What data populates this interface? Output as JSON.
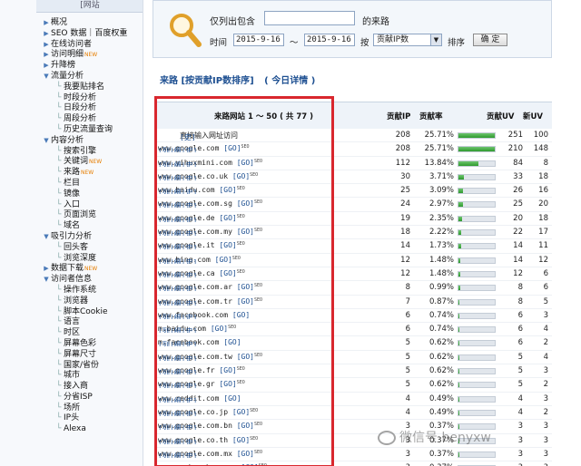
{
  "sidebar": {
    "site_name": "[网站",
    "items": [
      {
        "label": "概况",
        "level": 0
      },
      {
        "label": "SEO 数据｜百度权重",
        "level": 0
      },
      {
        "label": "在线访问者",
        "level": 0
      },
      {
        "label": "访问明细",
        "level": 0,
        "badge": "NEW"
      },
      {
        "label": "升降榜",
        "level": 0
      },
      {
        "label": "流量分析",
        "level": 0,
        "expanded": true
      },
      {
        "label": "我要贴排名",
        "level": 1
      },
      {
        "label": "时段分析",
        "level": 1
      },
      {
        "label": "日段分析",
        "level": 1
      },
      {
        "label": "周段分析",
        "level": 1
      },
      {
        "label": "历史流量查询",
        "level": 1
      },
      {
        "label": "内容分析",
        "level": 0,
        "expanded": true
      },
      {
        "label": "搜索引擎",
        "level": 1
      },
      {
        "label": "关键词",
        "level": 1,
        "badge": "NEW"
      },
      {
        "label": "来路",
        "level": 1,
        "badge": "NEW"
      },
      {
        "label": "栏目",
        "level": 1
      },
      {
        "label": "镜像",
        "level": 1
      },
      {
        "label": "入口",
        "level": 1
      },
      {
        "label": "页面浏览",
        "level": 1
      },
      {
        "label": "域名",
        "level": 1
      },
      {
        "label": "吸引力分析",
        "level": 0,
        "expanded": true
      },
      {
        "label": "回头客",
        "level": 1
      },
      {
        "label": "浏览深度",
        "level": 1
      },
      {
        "label": "数据下载",
        "level": 0,
        "badge": "NEW"
      },
      {
        "label": "访问者信息",
        "level": 0,
        "expanded": true
      },
      {
        "label": "操作系统",
        "level": 1
      },
      {
        "label": "浏览器",
        "level": 1
      },
      {
        "label": "脚本Cookie",
        "level": 1
      },
      {
        "label": "语言",
        "level": 1
      },
      {
        "label": "时区",
        "level": 1
      },
      {
        "label": "屏幕色彩",
        "level": 1
      },
      {
        "label": "屏幕尺寸",
        "level": 1
      },
      {
        "label": "国家/省份",
        "level": 1
      },
      {
        "label": "城市",
        "level": 1
      },
      {
        "label": "接入商",
        "level": 1
      },
      {
        "label": "分省ISP",
        "level": 1
      },
      {
        "label": "场所",
        "level": 1
      },
      {
        "label": "IP头",
        "level": 1
      },
      {
        "label": "Alexa",
        "level": 1
      }
    ]
  },
  "filter": {
    "include_label": "仅列出包含",
    "include_value": "",
    "include_suffix": "的来路",
    "time_label": "时间",
    "date_from": "2015-9-16",
    "tilde": "～",
    "date_to": "2015-9-16",
    "by_label": "按",
    "sort_value": "贡献IP数",
    "sort_label": "排序",
    "confirm_button": "确 定"
  },
  "crumb": {
    "title": "来路 [按贡献IP数排序]",
    "today_link": "( 今日详情 )"
  },
  "table": {
    "headers": {
      "site": "来路网站 1 ～ 50 ( 共 77 )",
      "ip": "贡献IP",
      "rate": "贡献率",
      "uv": "贡献UV",
      "new_uv": "新UV"
    },
    "rows": [
      {
        "links": "[史]",
        "site": "直接输入网址访问",
        "seo": false,
        "go": false,
        "ip": "208",
        "rate": "25.71%",
        "bar": 1.0,
        "uv": "251",
        "new_uv": "100"
      },
      {
        "links": "[列|细|史]",
        "site": "www.google.com",
        "seo": true,
        "go": true,
        "ip": "208",
        "rate": "25.71%",
        "bar": 1.0,
        "uv": "210",
        "new_uv": "148"
      },
      {
        "links": "[列|细|史]",
        "site": "www.yihuxmini.com",
        "seo": true,
        "go": true,
        "ip": "112",
        "rate": "13.84%",
        "bar": 0.54,
        "uv": "84",
        "new_uv": "8"
      },
      {
        "links": "[列|细|史]",
        "site": "www.google.co.uk",
        "seo": true,
        "go": true,
        "ip": "30",
        "rate": "3.71%",
        "bar": 0.145,
        "uv": "33",
        "new_uv": "18"
      },
      {
        "links": "[列|细|史]",
        "site": "www.baidu.com",
        "seo": true,
        "go": true,
        "ip": "25",
        "rate": "3.09%",
        "bar": 0.12,
        "uv": "26",
        "new_uv": "16"
      },
      {
        "links": "[列|细|史]",
        "site": "www.google.com.sg",
        "seo": true,
        "go": true,
        "ip": "24",
        "rate": "2.97%",
        "bar": 0.115,
        "uv": "25",
        "new_uv": "20"
      },
      {
        "links": "[列|细|史]",
        "site": "www.google.de",
        "seo": true,
        "go": true,
        "ip": "19",
        "rate": "2.35%",
        "bar": 0.09,
        "uv": "20",
        "new_uv": "18"
      },
      {
        "links": "[列|细|史]",
        "site": "www.google.com.my",
        "seo": true,
        "go": true,
        "ip": "18",
        "rate": "2.22%",
        "bar": 0.087,
        "uv": "22",
        "new_uv": "17"
      },
      {
        "links": "[列|细|史]",
        "site": "www.google.it",
        "seo": true,
        "go": true,
        "ip": "14",
        "rate": "1.73%",
        "bar": 0.067,
        "uv": "14",
        "new_uv": "11"
      },
      {
        "links": "[列|细|史]",
        "site": "www.bing.com",
        "seo": true,
        "go": true,
        "ip": "12",
        "rate": "1.48%",
        "bar": 0.058,
        "uv": "14",
        "new_uv": "12"
      },
      {
        "links": "[列|细|史]",
        "site": "www.google.ca",
        "seo": true,
        "go": true,
        "ip": "12",
        "rate": "1.48%",
        "bar": 0.058,
        "uv": "12",
        "new_uv": "6"
      },
      {
        "links": "[列|细|史]",
        "site": "www.google.com.ar",
        "seo": true,
        "go": true,
        "ip": "8",
        "rate": "0.99%",
        "bar": 0.038,
        "uv": "8",
        "new_uv": "6"
      },
      {
        "links": "[列|细|史]",
        "site": "www.google.com.tr",
        "seo": true,
        "go": true,
        "ip": "7",
        "rate": "0.87%",
        "bar": 0.034,
        "uv": "8",
        "new_uv": "5"
      },
      {
        "links": "[列|细|史]",
        "site": "www.facebook.com",
        "seo": false,
        "go": true,
        "ip": "6",
        "rate": "0.74%",
        "bar": 0.029,
        "uv": "6",
        "new_uv": "3"
      },
      {
        "links": "[列|细|史]",
        "site": "m.baidu.com",
        "seo": true,
        "go": true,
        "ip": "6",
        "rate": "0.74%",
        "bar": 0.029,
        "uv": "6",
        "new_uv": "4"
      },
      {
        "links": "[列|细|史]",
        "site": "m.facebook.com",
        "seo": false,
        "go": true,
        "ip": "5",
        "rate": "0.62%",
        "bar": 0.024,
        "uv": "6",
        "new_uv": "2"
      },
      {
        "links": "[列|细|史]",
        "site": "www.google.com.tw",
        "seo": true,
        "go": true,
        "ip": "5",
        "rate": "0.62%",
        "bar": 0.024,
        "uv": "5",
        "new_uv": "4"
      },
      {
        "links": "[列|细|史]",
        "site": "www.google.fr",
        "seo": true,
        "go": true,
        "ip": "5",
        "rate": "0.62%",
        "bar": 0.024,
        "uv": "5",
        "new_uv": "3"
      },
      {
        "links": "[列|细|史]",
        "site": "www.google.gr",
        "seo": true,
        "go": true,
        "ip": "5",
        "rate": "0.62%",
        "bar": 0.024,
        "uv": "5",
        "new_uv": "2"
      },
      {
        "links": "[列|细|史]",
        "site": "www.reddit.com",
        "seo": false,
        "go": true,
        "ip": "4",
        "rate": "0.49%",
        "bar": 0.019,
        "uv": "4",
        "new_uv": "3"
      },
      {
        "links": "[列|细|史]",
        "site": "www.google.co.jp",
        "seo": true,
        "go": true,
        "ip": "4",
        "rate": "0.49%",
        "bar": 0.019,
        "uv": "4",
        "new_uv": "2"
      },
      {
        "links": "[列|细|史]",
        "site": "www.google.com.bn",
        "seo": true,
        "go": true,
        "ip": "3",
        "rate": "0.37%",
        "bar": 0.014,
        "uv": "3",
        "new_uv": "3"
      },
      {
        "links": "[列|细|史]",
        "site": "www.google.co.th",
        "seo": true,
        "go": true,
        "ip": "3",
        "rate": "0.37%",
        "bar": 0.014,
        "uv": "3",
        "new_uv": "3"
      },
      {
        "links": "[列|细|史]",
        "site": "www.google.com.mx",
        "seo": true,
        "go": true,
        "ip": "3",
        "rate": "0.37%",
        "bar": 0.014,
        "uv": "3",
        "new_uv": "3"
      },
      {
        "links": "[列|细|史]",
        "site": "r.search.yahoo.com",
        "seo": true,
        "go": true,
        "ip": "3",
        "rate": "0.37%",
        "bar": 0.014,
        "uv": "3",
        "new_uv": "3"
      }
    ]
  },
  "watermark": {
    "text": "微信号 benyxw"
  },
  "colors": {
    "highlight": "#d9272e",
    "link": "#1d4f91",
    "bar": "#2e9a2e"
  }
}
